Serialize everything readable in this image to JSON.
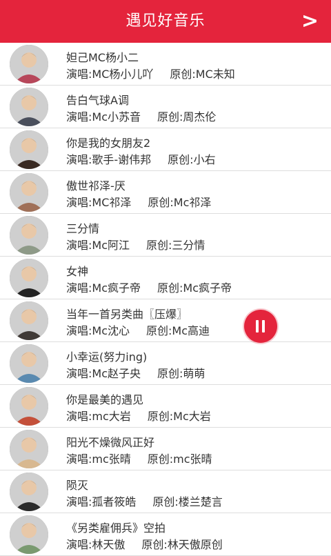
{
  "header": {
    "title": "遇见好音乐",
    "next_label": ">"
  },
  "songs": [
    {
      "title": "妲己MC杨小二",
      "singer": "演唱:MC杨小儿吖",
      "original": "原创:MC未知",
      "avatar": "#b7475a"
    },
    {
      "title": "告白气球A调",
      "singer": "演唱:Mc小苏音",
      "original": "原创:周杰伦",
      "avatar": "#4a4f5c"
    },
    {
      "title": "你是我的女朋友2",
      "singer": "演唱:歌手-谢伟邦",
      "original": "原创:小右",
      "avatar": "#3a2a22"
    },
    {
      "title": "傲世祁泽-厌",
      "singer": "演唱:MC祁泽",
      "original": "原创:Mc祁泽",
      "avatar": "#a07058"
    },
    {
      "title": "三分情",
      "singer": "演唱:Mc阿江",
      "original": "原创:三分情",
      "avatar": "#8e9a88"
    },
    {
      "title": "女神",
      "singer": "演唱:Mc疯子帝",
      "original": "原创:Mc疯子帝",
      "avatar": "#222222"
    },
    {
      "title": "当年一首另类曲〖压爆〗",
      "singer": "演唱:Mc沈心",
      "original": "原创:Mc高迪",
      "avatar": "#403a36"
    },
    {
      "title": "小幸运(努力ing)",
      "singer": "演唱:Mc赵子央",
      "original": "原创:萌萌",
      "avatar": "#5a8ab0"
    },
    {
      "title": "你是最美的遇见",
      "singer": "演唱:mc大岩",
      "original": "原创:Mc大岩",
      "avatar": "#c4503a"
    },
    {
      "title": "阳光不燥微风正好",
      "singer": "演唱:mc张晴",
      "original": "原创:mc张晴",
      "avatar": "#d8b890"
    },
    {
      "title": "陨灭",
      "singer": "演唱:孤者筱皓",
      "original": "原创:楼兰楚言",
      "avatar": "#2a2a2a"
    },
    {
      "title": "《另类雇佣兵》空拍",
      "singer": "演唱:林天傲",
      "original": "原创:林天傲原创",
      "avatar": "#7a9a70"
    }
  ],
  "colors": {
    "accent": "#e4243c"
  },
  "icons": {
    "next": "chevron-right-icon",
    "pause": "pause-icon"
  }
}
